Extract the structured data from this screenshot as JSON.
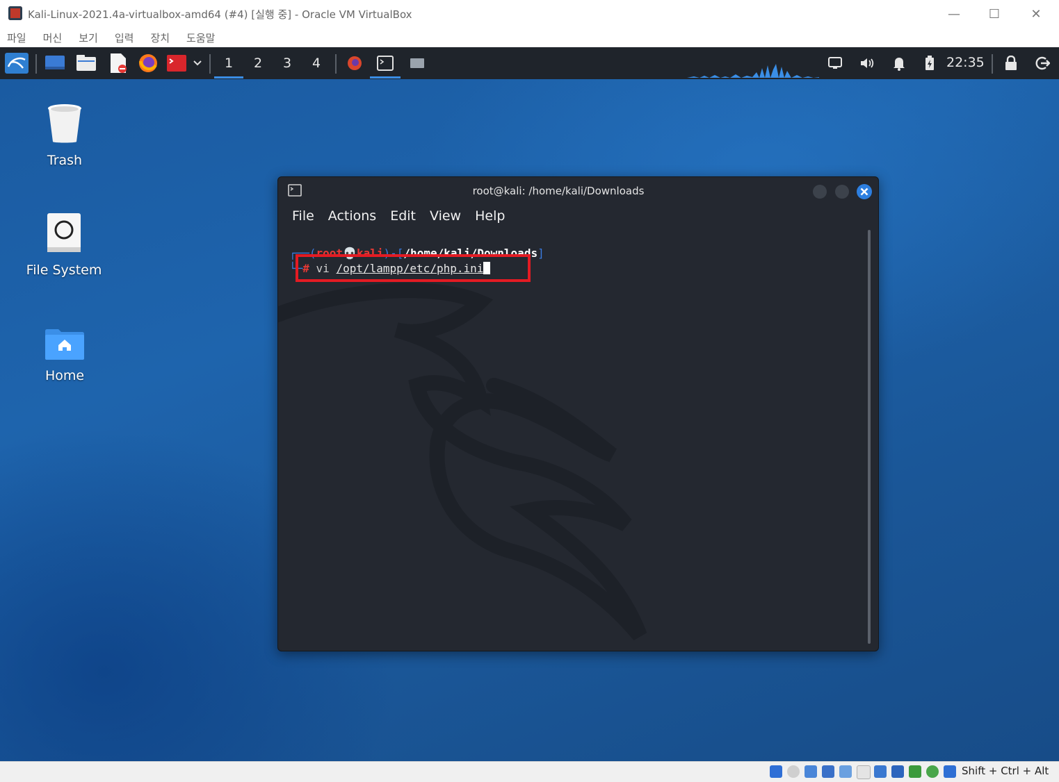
{
  "host_window": {
    "title": "Kali-Linux-2021.4a-virtualbox-amd64 (#4) [실행 중] - Oracle VM VirtualBox",
    "menu": [
      "파일",
      "머신",
      "보기",
      "입력",
      "장치",
      "도움말"
    ],
    "controls": {
      "minimize": "—",
      "maximize": "☐",
      "close": "✕"
    }
  },
  "panel": {
    "workspaces": [
      "1",
      "2",
      "3",
      "4"
    ],
    "active_workspace": "1",
    "clock": "22:35",
    "icons": [
      "kali-menu-icon",
      "desktop-icon",
      "file-manager-icon",
      "text-editor-icon",
      "firefox-icon",
      "terminal-red-icon",
      "chevron-down-icon",
      "app-firefox-task-icon",
      "app-terminal-task-icon",
      "app-window-task-icon",
      "display-icon",
      "volume-icon",
      "bell-icon",
      "battery-icon",
      "lock-icon",
      "logout-icon"
    ]
  },
  "desktop": {
    "icons": [
      {
        "label": "Trash"
      },
      {
        "label": "File System"
      },
      {
        "label": "Home"
      }
    ]
  },
  "terminal": {
    "title": "root@kali: /home/kali/Downloads",
    "menu": [
      "File",
      "Actions",
      "Edit",
      "View",
      "Help"
    ],
    "prompt_user": "root",
    "prompt_host": "kali",
    "prompt_path": "/home/kali/Downloads",
    "prompt_symbol": "#",
    "command": "vi",
    "argument": "/opt/lampp/etc/php.ini",
    "colors": {
      "user": "#e53935",
      "path": "#ffffff",
      "bracket": "#3a7be0",
      "highlight": "#e31b23"
    }
  },
  "statusbar": {
    "hostkey": "Shift + Ctrl + Alt"
  }
}
